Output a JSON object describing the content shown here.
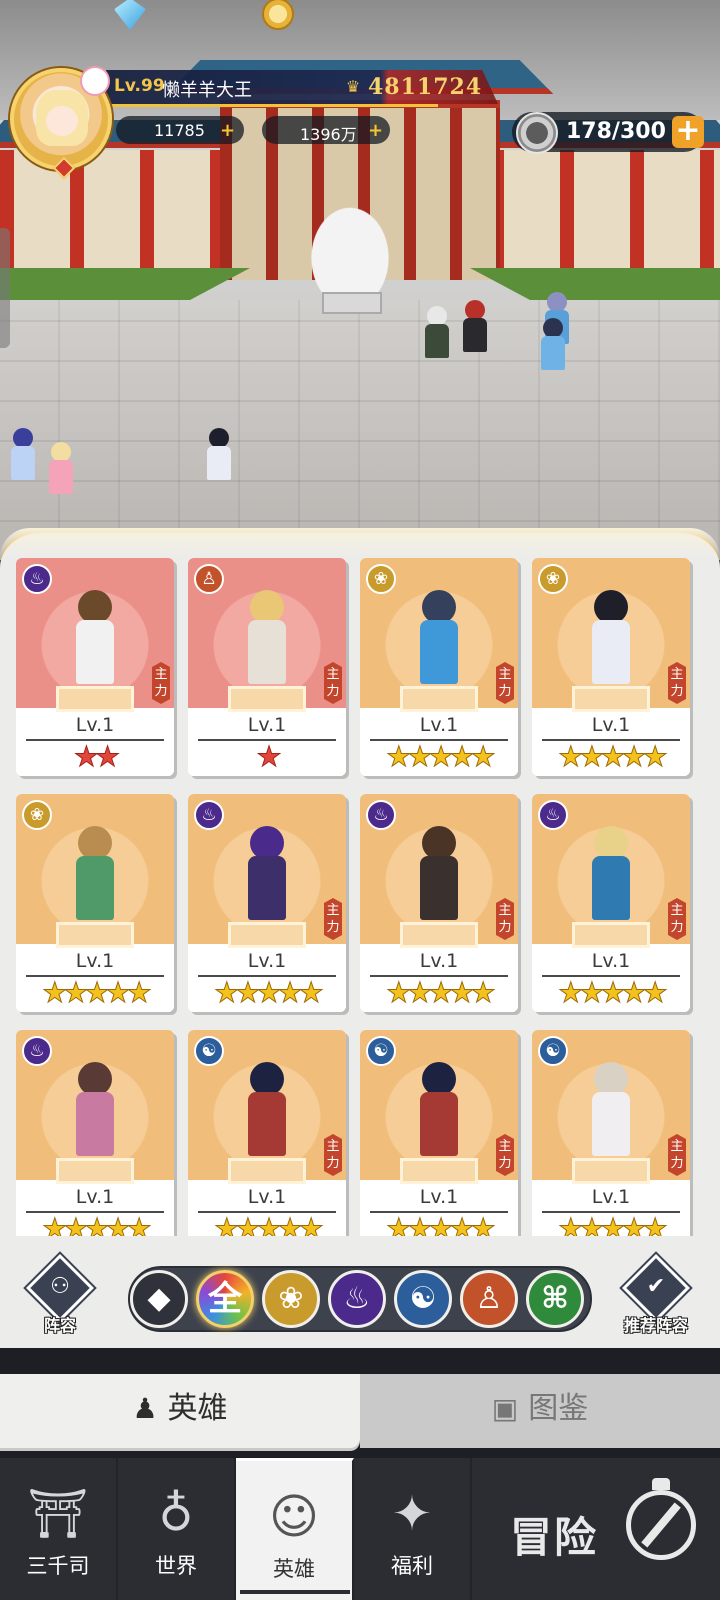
{
  "player": {
    "level": "Lv.99",
    "name": "懒羊羊大王",
    "power": "4811724"
  },
  "resources": {
    "gems": "11785",
    "gold": "1396万",
    "stamina": "178/300"
  },
  "hero_cards": [
    {
      "level": "Lv.1",
      "stars": "★★",
      "star_color": "red",
      "faction": "fire",
      "main_tag": "主力"
    },
    {
      "level": "Lv.1",
      "stars": "★",
      "star_color": "red",
      "faction": "monk",
      "main_tag": "主力"
    },
    {
      "level": "Lv.1",
      "stars": "★★★★★",
      "star_color": "gold",
      "faction": "lotus",
      "main_tag": "主力"
    },
    {
      "level": "Lv.1",
      "stars": "★★★★★",
      "star_color": "gold",
      "faction": "lotus",
      "main_tag": "主力"
    },
    {
      "level": "Lv.1",
      "stars": "★★★★★",
      "star_color": "gold",
      "faction": "lotus",
      "main_tag": ""
    },
    {
      "level": "Lv.1",
      "stars": "★★★★★",
      "star_color": "gold",
      "faction": "fire",
      "main_tag": "主力"
    },
    {
      "level": "Lv.1",
      "stars": "★★★★★",
      "star_color": "gold",
      "faction": "fire",
      "main_tag": "主力"
    },
    {
      "level": "Lv.1",
      "stars": "★★★★★",
      "star_color": "gold",
      "faction": "fire",
      "main_tag": "主力"
    },
    {
      "level": "Lv.1",
      "stars": "★★★★★",
      "star_color": "gold",
      "faction": "fire",
      "main_tag": ""
    },
    {
      "level": "Lv.1",
      "stars": "★★★★★",
      "star_color": "gold",
      "faction": "wind",
      "main_tag": "主力"
    },
    {
      "level": "Lv.1",
      "stars": "★★★★★",
      "star_color": "gold",
      "faction": "wind",
      "main_tag": "主力"
    },
    {
      "level": "Lv.1",
      "stars": "★★★★★",
      "star_color": "gold",
      "faction": "wind",
      "main_tag": "主力"
    }
  ],
  "filter_bar": {
    "formation_label": "阵容",
    "recommend_label": "推荐阵容",
    "all_label": "全",
    "filters": [
      "formation-icon",
      "all",
      "lotus-icon",
      "fire-icon",
      "wind-icon",
      "monk-icon",
      "dna-icon"
    ]
  },
  "section_tabs": {
    "heroes": "英雄",
    "codex": "图鉴"
  },
  "bottom_nav": {
    "items": [
      "三千司",
      "世界",
      "英雄",
      "福利"
    ],
    "active": "英雄",
    "adventure": "冒险"
  },
  "colors": {
    "accent_gold": "#f4c21c",
    "star_red": "#e2463b",
    "nav_bg": "#2b2d33",
    "panel_bg": "#ececea"
  }
}
